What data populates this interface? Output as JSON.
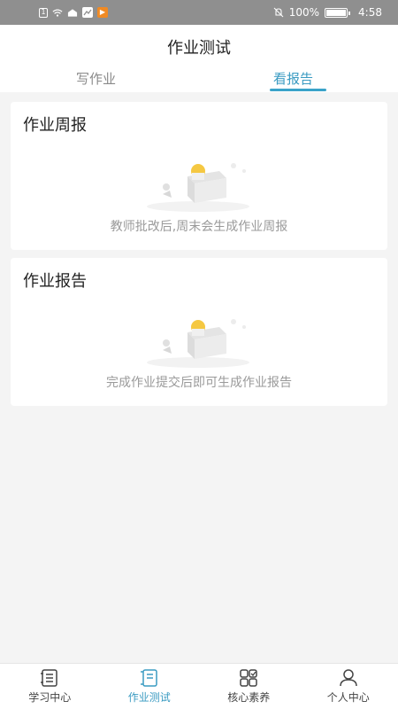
{
  "status_bar": {
    "battery": "100%",
    "time": "4:58"
  },
  "header": {
    "title": "作业测试",
    "tabs": [
      {
        "label": "写作业",
        "active": false
      },
      {
        "label": "看报告",
        "active": true
      }
    ]
  },
  "cards": [
    {
      "title": "作业周报",
      "empty_message": "教师批改后,周末会生成作业周报"
    },
    {
      "title": "作业报告",
      "empty_message": "完成作业提交后即可生成作业报告"
    }
  ],
  "bottom_nav": [
    {
      "label": "学习中心",
      "icon": "book-list-icon",
      "active": false
    },
    {
      "label": "作业测试",
      "icon": "homework-icon",
      "active": true
    },
    {
      "label": "核心素养",
      "icon": "grid-icon",
      "active": false
    },
    {
      "label": "个人中心",
      "icon": "person-icon",
      "active": false
    }
  ],
  "colors": {
    "accent": "#3a9bc2",
    "status_bar": "#8f8f8f",
    "background": "#f4f4f4"
  }
}
